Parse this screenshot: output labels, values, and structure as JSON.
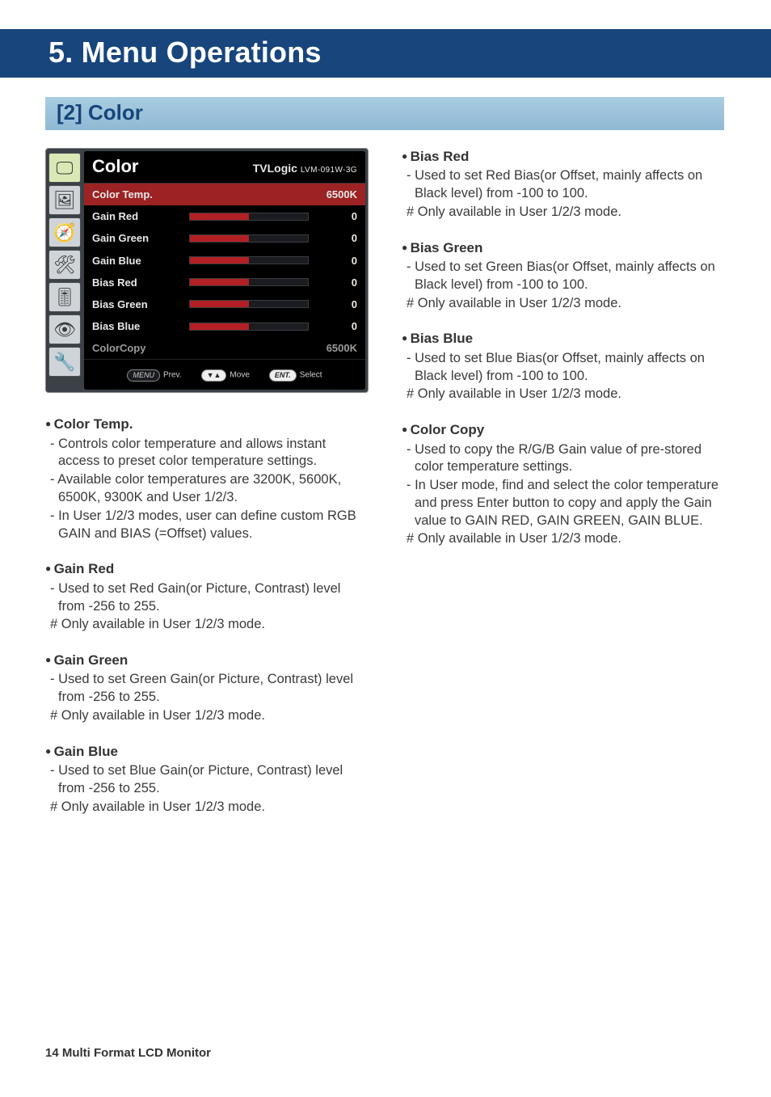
{
  "chapter_title": "5. Menu Operations",
  "section_title": "[2] Color",
  "osd": {
    "title": "Color",
    "brand": "TVLogic",
    "model": "LVM-091W-3G",
    "rows": [
      {
        "label": "Color Temp.",
        "value": "6500K",
        "has_bar": false,
        "selected": true
      },
      {
        "label": "Gain Red",
        "value": "0",
        "has_bar": true
      },
      {
        "label": "Gain Green",
        "value": "0",
        "has_bar": true
      },
      {
        "label": "Gain Blue",
        "value": "0",
        "has_bar": true
      },
      {
        "label": "Bias Red",
        "value": "0",
        "has_bar": true
      },
      {
        "label": "Bias Green",
        "value": "0",
        "has_bar": true
      },
      {
        "label": "Bias Blue",
        "value": "0",
        "has_bar": true
      },
      {
        "label": "ColorCopy",
        "value": "6500K",
        "has_bar": false
      }
    ],
    "foot": {
      "prev_btn": "MENU",
      "prev": "Prev.",
      "move_btn": "▼▲",
      "move": "Move",
      "select_btn": "ENT.",
      "select": "Select"
    },
    "tab_icons": [
      "🖵",
      "🖼",
      "🧭",
      "🛠",
      "🎚",
      "👁",
      "🔧"
    ]
  },
  "left_items": [
    {
      "title": "Color Temp.",
      "lines": [
        "- Controls color temperature and allows instant access to preset color temperature settings.",
        "- Available color temperatures are 3200K, 5600K, 6500K, 9300K and User 1/2/3.",
        "- In User 1/2/3 modes, user can define custom RGB GAIN and BIAS (=Offset) values."
      ]
    },
    {
      "title": "Gain Red",
      "lines": [
        "- Used to set Red Gain(or Picture, Contrast) level from -256 to 255.",
        "# Only available in User 1/2/3 mode."
      ]
    },
    {
      "title": "Gain Green",
      "lines": [
        "- Used to set Green Gain(or Picture, Contrast) level from -256 to 255.",
        "# Only available in User 1/2/3 mode."
      ]
    },
    {
      "title": "Gain Blue",
      "lines": [
        "- Used to set Blue Gain(or Picture, Contrast) level from -256 to 255.",
        "# Only available in User 1/2/3 mode."
      ]
    }
  ],
  "right_items": [
    {
      "title": "Bias Red",
      "lines": [
        "- Used to set Red Bias(or Offset, mainly affects on Black level) from -100 to 100.",
        "# Only available in User 1/2/3 mode."
      ]
    },
    {
      "title": "Bias Green",
      "lines": [
        "- Used to set Green Bias(or Offset, mainly affects on Black level) from -100 to 100.",
        "# Only available in User 1/2/3 mode."
      ]
    },
    {
      "title": "Bias Blue",
      "lines": [
        "- Used to set Blue Bias(or Offset, mainly affects on Black level) from -100 to 100.",
        "# Only available in User 1/2/3 mode."
      ]
    },
    {
      "title": "Color Copy",
      "lines": [
        "- Used to copy the R/G/B  Gain value of pre-stored color temperature settings.",
        "- In User mode, find and select the color temperature and press Enter button to copy and apply the Gain value to GAIN RED, GAIN GREEN, GAIN BLUE.",
        "# Only available in User 1/2/3 mode."
      ]
    }
  ],
  "footer": "14 Multi Format LCD Monitor"
}
